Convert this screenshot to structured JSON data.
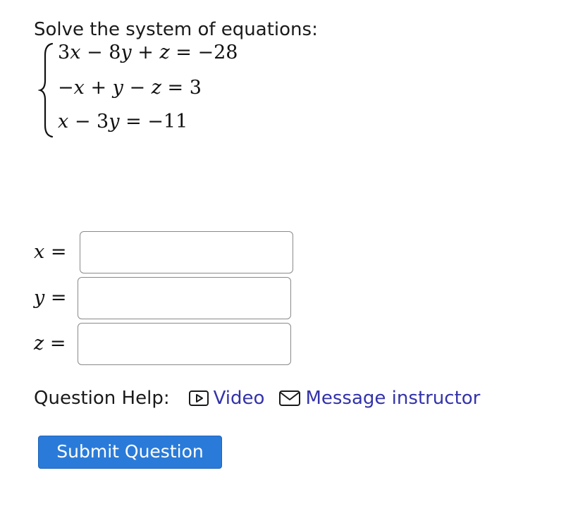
{
  "question": {
    "prompt": "Solve the system of equations:",
    "equations": {
      "eq1": {
        "c1": "3",
        "v1": "x",
        "op1": " − ",
        "c2": "8",
        "v2": "y",
        "op2": " + ",
        "v3": "z",
        "rhs": " = −28"
      },
      "eq2": {
        "c1": "−",
        "v1": "x",
        "op1": " + ",
        "v2": "y",
        "op2": " − ",
        "v3": "z",
        "rhs": " = 3"
      },
      "eq3": {
        "v1": "x",
        "op1": " − ",
        "c2": "3",
        "v2": "y",
        "rhs": " = −11"
      }
    }
  },
  "answers": {
    "x": {
      "var": "x",
      "eq": " =",
      "value": ""
    },
    "y": {
      "var": "y",
      "eq": " =",
      "value": ""
    },
    "z": {
      "var": "z",
      "eq": " =",
      "value": ""
    }
  },
  "help": {
    "label": "Question Help:",
    "video": "Video",
    "message": "Message instructor"
  },
  "submit_label": "Submit Question",
  "colors": {
    "link": "#3333aa",
    "submit_bg": "#2a7bd9",
    "input_border": "#8a8a8a"
  },
  "icons": {
    "video": "play-icon",
    "message": "envelope-icon"
  }
}
